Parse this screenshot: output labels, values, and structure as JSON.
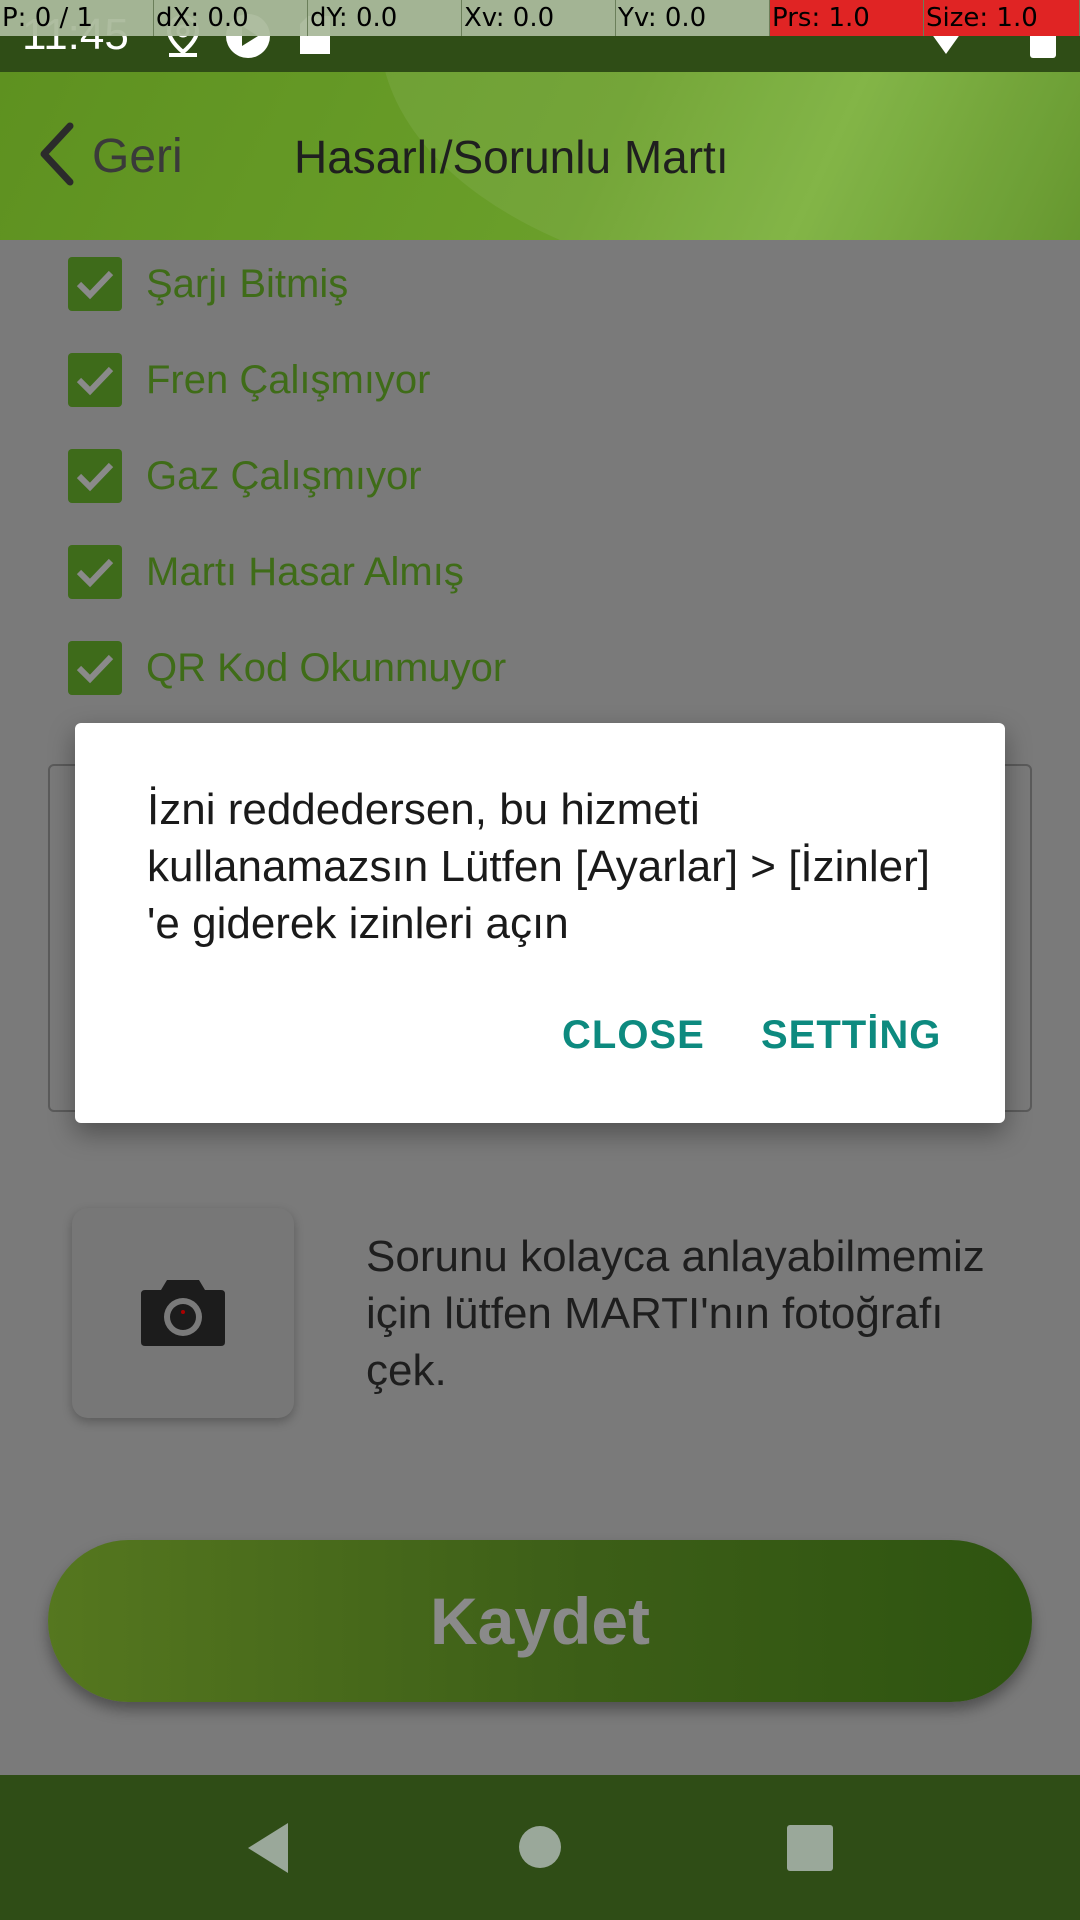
{
  "status_bar": {
    "time": "11:45",
    "icons": [
      "location-pin-icon",
      "sync-icon",
      "sd-card-icon",
      "wifi-icon",
      "battery-icon"
    ]
  },
  "debug_overlay": {
    "p": "P: 0 / 1",
    "dx": "dX: 0.0",
    "dy": "dY: 0.0",
    "xv": "Xv: 0.0",
    "yv": "Yv: 0.0",
    "prs": "Prs: 1.0",
    "size": "Size: 1.0"
  },
  "header": {
    "back_label": "Geri",
    "title": "Hasarlı/Sorunlu Martı"
  },
  "checklist": [
    {
      "label": "Şarjı Bitmiş",
      "checked": true
    },
    {
      "label": "Fren Çalışmıyor",
      "checked": true
    },
    {
      "label": "Gaz Çalışmıyor",
      "checked": true
    },
    {
      "label": "Martı Hasar Almış",
      "checked": true
    },
    {
      "label": "QR Kod Okunmuyor",
      "checked": true
    }
  ],
  "photo": {
    "hint": "Sorunu kolayca anlayabilmemiz için lütfen MARTI'nın fotoğrafı çek."
  },
  "save_button": {
    "label": "Kaydet"
  },
  "dialog": {
    "message": "İzni reddedersen, bu hizmeti kullanamazsın Lütfen [Ayarlar] > [İzinler] 'e giderek izinleri açın",
    "close_label": "CLOSE",
    "setting_label": "SETTİNG"
  },
  "colors": {
    "brand_green": "#5e9120",
    "dialog_button": "#0d8a7f"
  }
}
